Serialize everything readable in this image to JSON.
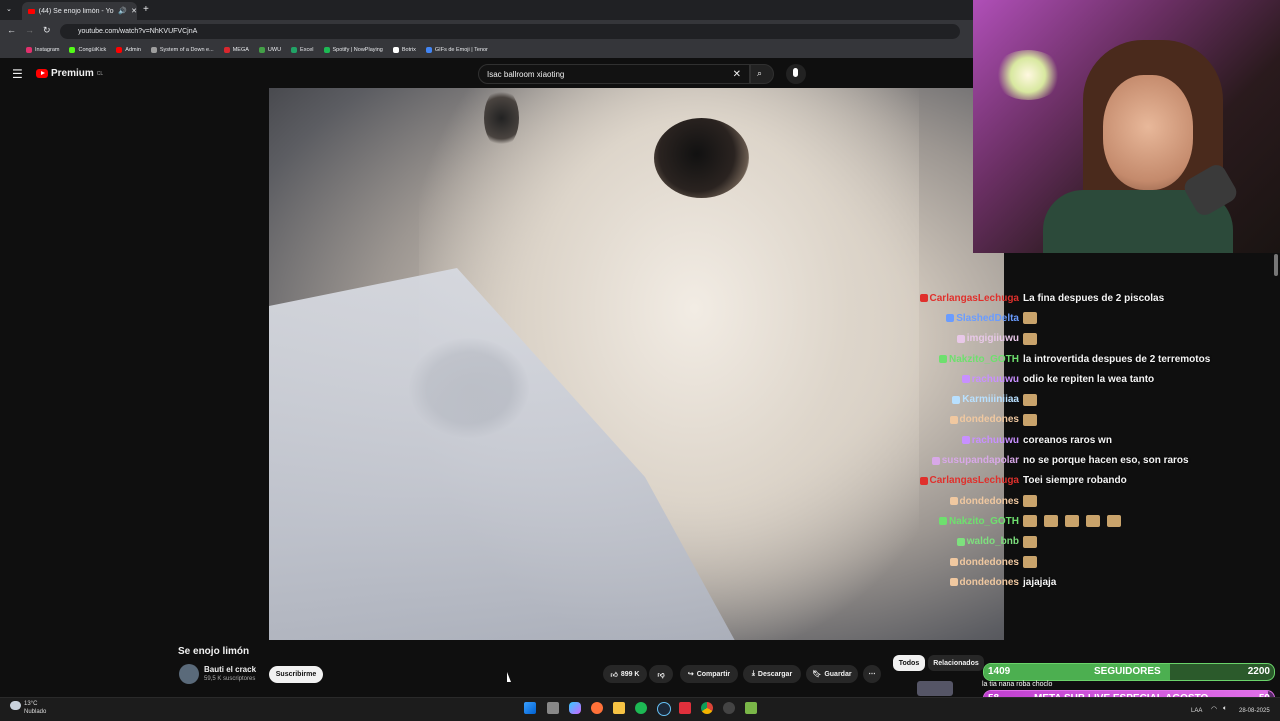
{
  "browser": {
    "tab_title": "(44) Se enojo limón - YouTube",
    "url": "youtube.com/watch?v=NhKVUFVCjnA",
    "bookmarks": [
      {
        "label": "Instagram",
        "color": "#e1306c"
      },
      {
        "label": "CongüiKick",
        "color": "#53fc18"
      },
      {
        "label": "Admin",
        "color": "#ff0000"
      },
      {
        "label": "System of a Down e...",
        "color": "#9e9e9e"
      },
      {
        "label": "MEGA",
        "color": "#d9272e"
      },
      {
        "label": "UWU",
        "color": "#43a047"
      },
      {
        "label": "Excel",
        "color": "#21a366"
      },
      {
        "label": "Spotify | NowPlaying",
        "color": "#1db954"
      },
      {
        "label": "Botrix",
        "color": "#ffffff"
      },
      {
        "label": "GIFs de Emoji | Tenor",
        "color": "#4285f4"
      }
    ]
  },
  "youtube": {
    "logo_text": "Premium",
    "logo_superscript": "CL",
    "search_value": "Isac ballroom xiaoting",
    "video_title": "Se enojo limón",
    "channel_name": "Bauti el crack",
    "subscribers": "59,5 K suscriptores",
    "subscribe_label": "Suscribirme",
    "likes": "899 K",
    "share_label": "Compartir",
    "download_label": "Descargar",
    "save_label": "Guardar",
    "chip_all": "Todos",
    "chip_related": "Relacionados"
  },
  "chat": [
    {
      "user": "CarlangasLechuga",
      "color": "#e0302c",
      "msg": "La fina despues de 2 piscolas",
      "emotes": 0
    },
    {
      "user": "SlashedDelta",
      "color": "#6a9cff",
      "msg": "",
      "emotes": 1
    },
    {
      "user": "imgigiiuwu",
      "color": "#e8c8e8",
      "msg": "",
      "emotes": 1
    },
    {
      "user": "Nakzito_GOTH",
      "color": "#6ee06e",
      "msg": "la introvertida despues de 2 terremotos",
      "emotes": 0
    },
    {
      "user": "rachuuwu",
      "color": "#c890ff",
      "msg": "odio ke repiten la wea tanto",
      "emotes": 0
    },
    {
      "user": "Karmiiiniiaa",
      "color": "#b8e0ff",
      "msg": "",
      "emotes": 1
    },
    {
      "user": "dondedones",
      "color": "#f0c8a0",
      "msg": "",
      "emotes": 1
    },
    {
      "user": "rachuuwu",
      "color": "#c890ff",
      "msg": "coreanos raros wn",
      "emotes": 0
    },
    {
      "user": "susupandapolar",
      "color": "#d8a8e8",
      "msg": "no se porque hacen eso, son raros",
      "emotes": 0
    },
    {
      "user": "CarlangasLechuga",
      "color": "#e0302c",
      "msg": "Toei siempre robando",
      "emotes": 0
    },
    {
      "user": "dondedones",
      "color": "#f0c8a0",
      "msg": "",
      "emotes": 1
    },
    {
      "user": "Nakzito_GOTH",
      "color": "#6ee06e",
      "msg": "",
      "emotes": 5
    },
    {
      "user": "waldo_bnb",
      "color": "#7ee07e",
      "msg": "",
      "emotes": 1
    },
    {
      "user": "dondedones",
      "color": "#f0c8a0",
      "msg": "",
      "emotes": 1
    },
    {
      "user": "dondedones",
      "color": "#f0c8a0",
      "msg": "jajajaja",
      "emotes": 0
    }
  ],
  "overlay": {
    "followers_current": "1409",
    "followers_label": "SEGUIDORES",
    "followers_goal": "2200",
    "followers_progress": 0.64,
    "ticker": "la tia nana roba choclo",
    "subgoal_label": "META SUB LIVE ESPECIAL AGOSTO",
    "subgoal_current": "58",
    "subgoal_goal": "59",
    "subgoal_progress": 0.98
  },
  "taskbar": {
    "temperature": "13°C",
    "weather": "Nublado",
    "lang": "LAA",
    "date": "28-08-2025"
  }
}
